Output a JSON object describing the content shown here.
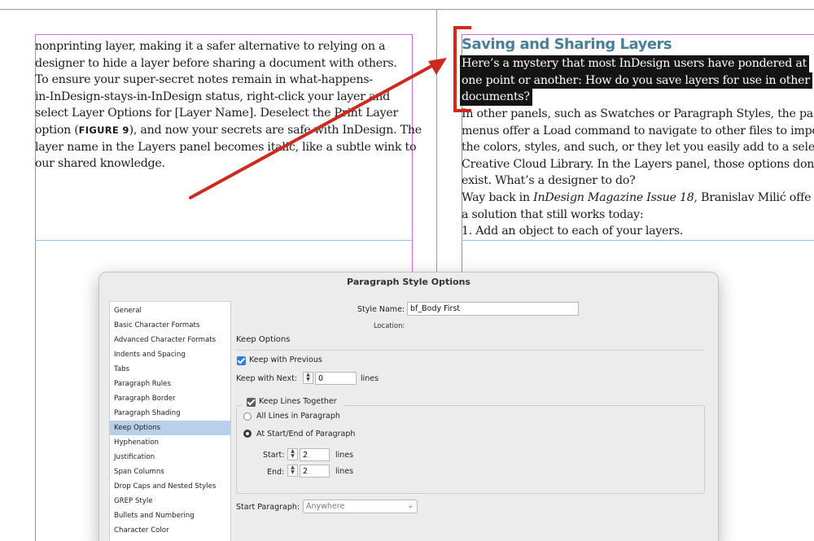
{
  "left_page": {
    "lines": [
      "nonprinting layer, making it a safer alternative to relying on a",
      "designer to hide a layer before sharing a document with others.",
      "   To ensure your super-secret notes remain in what-happens-",
      "in-InDesign-stays-in-InDesign status, right-click your layer and",
      "select Layer Options for [Layer Name]. Deselect the Print Layer"
    ],
    "fig_line_before": "option (",
    "fig_label": "FIGURE 9",
    "fig_line_after": "), and now your secrets are safe with InDesign. The",
    "lines_after": [
      "layer name in the Layers panel becomes italic, like a subtle wink to",
      "our shared knowledge."
    ]
  },
  "right_page": {
    "heading": "Saving and Sharing Layers",
    "highlighted_lines": [
      "Here’s a mystery that most InDesign users have pondered at",
      "one point or another: How do you save layers for use in other",
      "documents?"
    ],
    "lines": [
      "   In other panels, such as Swatches or Paragraph Styles, the pa",
      "menus offer a Load command to navigate to other files to impo",
      "the colors, styles, and such, or they let you easily add to a select",
      "Creative Cloud Library. In the Layers panel, those options don’t",
      "exist. What’s a designer to do?"
    ],
    "way_back_before": "   Way back in ",
    "way_back_italic": "InDesign Magazine Issue 18",
    "way_back_after": ", Branislav Milić offe",
    "line_solution": "a solution that still works today:",
    "list_item": "  1.  Add an object to each of your layers."
  },
  "annotation_colors": {
    "arrow": "#cc2a1f",
    "highlight": "#141414",
    "heading": "#4b7f98"
  },
  "dialog": {
    "title": "Paragraph Style Options",
    "sidebar": [
      "General",
      "Basic Character Formats",
      "Advanced Character Formats",
      "Indents and Spacing",
      "Tabs",
      "Paragraph Rules",
      "Paragraph Border",
      "Paragraph Shading",
      "Keep Options",
      "Hyphenation",
      "Justification",
      "Span Columns",
      "Drop Caps and Nested Styles",
      "GREP Style",
      "Bullets and Numbering",
      "Character Color"
    ],
    "selected_item": "Keep Options",
    "style_name_label": "Style Name:",
    "style_name_value": "bf_Body First",
    "location_label": "Location:",
    "section_title": "Keep Options",
    "keep_with_previous": "Keep with Previous",
    "keep_with_next_label": "Keep with Next:",
    "keep_with_next_value": "0",
    "lines_unit": "lines",
    "keep_lines_together": "Keep Lines Together",
    "all_lines": "All Lines in Paragraph",
    "at_start_end": "At Start/End of Paragraph",
    "start_label": "Start:",
    "start_value": "2",
    "end_label": "End:",
    "end_value": "2",
    "start_paragraph_label": "Start Paragraph:",
    "start_paragraph_value": "Anywhere"
  }
}
